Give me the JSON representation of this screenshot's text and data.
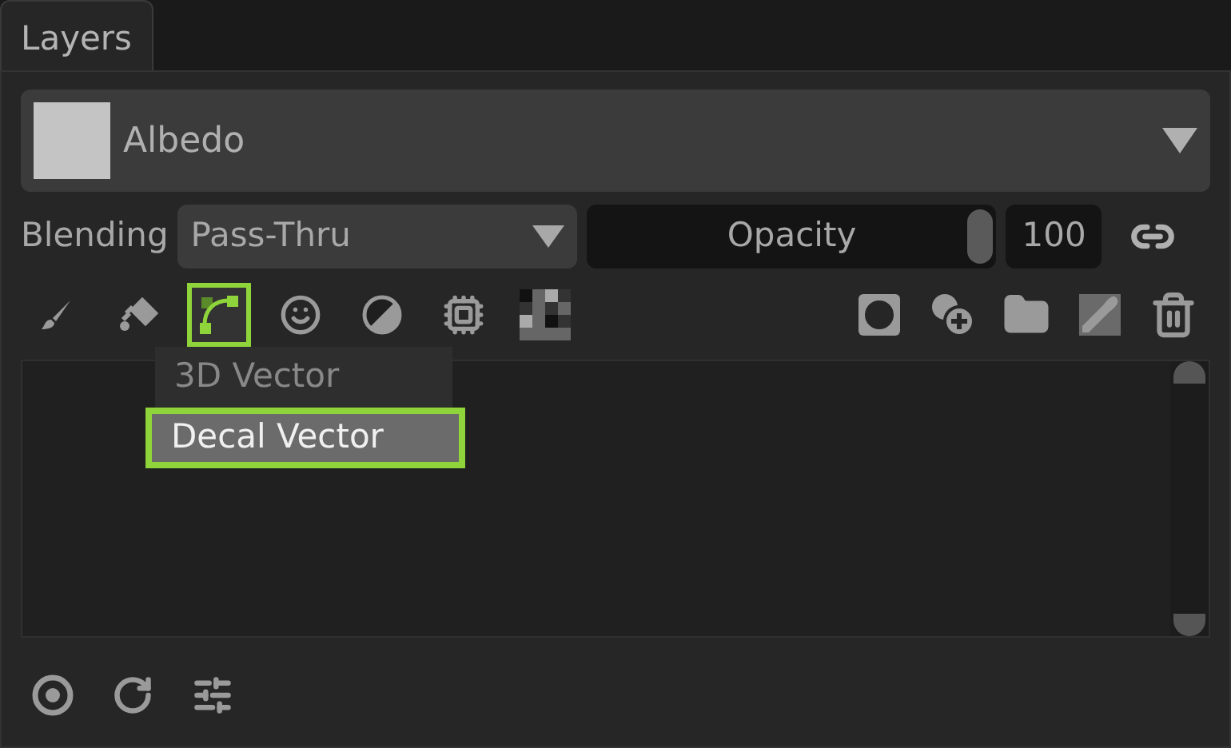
{
  "tab": {
    "label": "Layers",
    "selected": true
  },
  "material": {
    "name": "Albedo"
  },
  "blending": {
    "label": "Blending",
    "value": "Pass-Thru"
  },
  "opacity": {
    "label": "Opacity",
    "level": 1,
    "value": "100"
  },
  "tools": [
    {
      "kind": "brush",
      "selected": false
    },
    {
      "kind": "fill",
      "selected": false
    },
    {
      "kind": "vector",
      "selected": true
    },
    {
      "kind": "sticker",
      "selected": false
    },
    {
      "kind": "contrast",
      "selected": false
    },
    {
      "kind": "chip",
      "selected": false
    },
    {
      "kind": "checker",
      "selected": false
    }
  ],
  "layer_actions": [
    {
      "kind": "mask"
    },
    {
      "kind": "add"
    },
    {
      "kind": "folder"
    },
    {
      "kind": "picker"
    },
    {
      "kind": "trash"
    }
  ],
  "menu": [
    {
      "label": "3D Vector",
      "selected": false
    },
    {
      "label": "Decal Vector",
      "selected": true
    }
  ],
  "footer_actions": [
    {
      "kind": "target"
    },
    {
      "kind": "refresh"
    },
    {
      "kind": "sliders"
    }
  ]
}
